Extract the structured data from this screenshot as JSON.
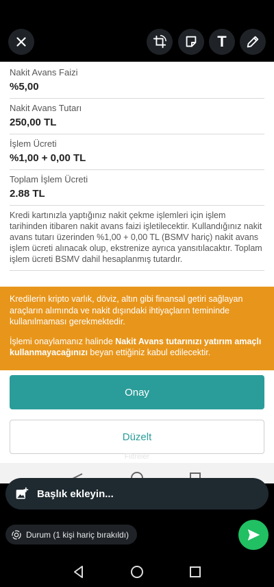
{
  "toolbar": {
    "close_icon": "close-icon",
    "crop_rotate_icon": "crop-rotate-icon",
    "sticker_icon": "sticker-icon",
    "text_icon_label": "T",
    "pencil_icon": "pencil-icon"
  },
  "fields": [
    {
      "label": "Nakit Avans Faizi",
      "value": "%5,00"
    },
    {
      "label": "Nakit Avans Tutarı",
      "value": "250,00 TL"
    },
    {
      "label": "İşlem Ücreti",
      "value": "%1,00 + 0,00 TL"
    },
    {
      "label": "Toplam İşlem Ücreti",
      "value": "2.88 TL"
    }
  ],
  "info_text": "Kredi kartınızla yaptığınız nakit çekme işlemleri için işlem tarihinden itibaren nakit avans faizi işletilecektir. Kullandığınız nakit avans tutarı üzerinden %1,00 + 0,00 TL (BSMV hariç) nakit avans işlem ücreti alınacak olup, ekstrenize ayrıca yansıtılacaktır. Toplam işlem ücreti BSMV dahil hesaplanmış tutardır.",
  "warning": {
    "p1": "Kredilerin kripto varlık, döviz, altın gibi finansal getiri sağlayan araçların alımında ve nakit dışındaki ihtiyaçların temininde kullanılmaması gerekmektedir.",
    "p2_prefix": "İşlemi onaylamanız halinde ",
    "p2_bold": "Nakit Avans tutarınızı yatırım amaçlı kullanmayacağınızı",
    "p2_suffix": " beyan ettiğiniz kabul edilecektir."
  },
  "buttons": {
    "confirm": "Onay",
    "edit": "Düzelt"
  },
  "filters_label": "Filtreler",
  "caption": {
    "placeholder": "Başlık ekleyin..."
  },
  "status_chip": "Durum (1 kişi hariç bırakıldı)",
  "colors": {
    "accent_teal": "#2a9d9a",
    "warning_orange": "#e8961b",
    "send_green": "#21c063"
  }
}
